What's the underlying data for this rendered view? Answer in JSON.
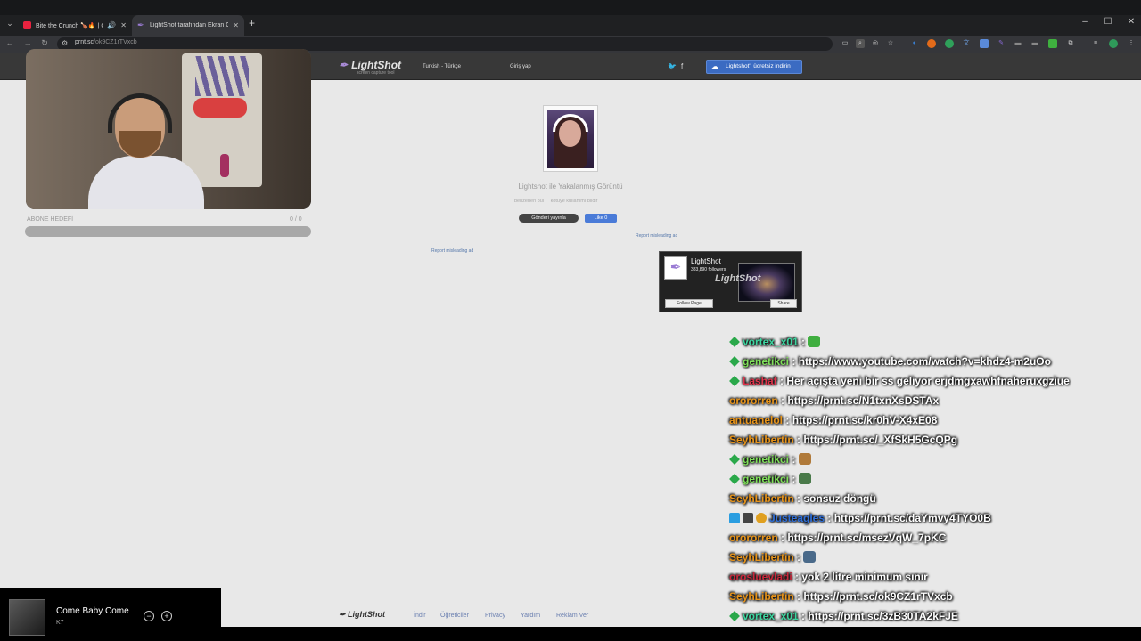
{
  "browser": {
    "tabs": [
      {
        "title": "Bite the Crunch 🍗🔥 | Chi",
        "favicon": "youtube-icon",
        "active": false
      },
      {
        "title": "LightShot tarafından Ekran Gör",
        "favicon": "lightshot-feather-icon",
        "active": true
      }
    ],
    "url_host": "prnt.sc",
    "url_path": "/ok9CZ1rTVxcb",
    "window_controls": [
      "minimize",
      "maximize",
      "close"
    ]
  },
  "lightshot": {
    "logo": "LightShot",
    "logo_sub": "screen capture tool",
    "language": "Turkish - Türkçe",
    "login": "Giriş yap",
    "download_button": "Lightshot'ı ücretsiz indirin",
    "caption": "Lightshot ile Yakalanmış Görüntü",
    "sublinks": [
      "benzerleri bul",
      "kötüye kullanımı bildir"
    ],
    "tweet_button": "Gönderi yayınla",
    "like_button": "Like 0",
    "report_ad": "Report misleading ad",
    "fb_widget": {
      "page_name": "LightShot",
      "followers": "383,890 followers",
      "follow_button": "Follow Page",
      "share_button": "Share",
      "watermark": "LightShot"
    },
    "footer": {
      "logo": "LightShot",
      "links": [
        "İndir",
        "Öğreticiler",
        "Privacy",
        "Yardım",
        "Reklam Ver"
      ]
    }
  },
  "overlay": {
    "webcam_label": "ABONE HEDEFİ",
    "webcam_count": "0 / 0",
    "chat": [
      {
        "user": "vortex_x01",
        "color": "#3dd6a0",
        "badges": [
          "mod"
        ],
        "text": "",
        "emote": "#3fae3f"
      },
      {
        "user": "genetikci",
        "color": "#7fe05a",
        "badges": [
          "mod"
        ],
        "text": "https://www.youtube.com/watch?v=khdz4-m2uOo",
        "emote": ""
      },
      {
        "user": "Lashaf",
        "color": "#e0344c",
        "badges": [
          "mod"
        ],
        "text": "Her açışta yeni bir ss geliyor erjdmgxawhfnaheruxgziue",
        "emote": ""
      },
      {
        "user": "orororren",
        "color": "#e8941a",
        "badges": [],
        "text": "https://prnt.sc/N1txnXsDSTAx",
        "emote": ""
      },
      {
        "user": "antuanelol",
        "color": "#e8941a",
        "badges": [],
        "text": "https://prnt.sc/kr0hV-X4xE08",
        "emote": ""
      },
      {
        "user": "SeyhLibertin",
        "color": "#e8941a",
        "badges": [],
        "text": "https://prnt.sc/_XfSkH5GcQPg",
        "emote": ""
      },
      {
        "user": "genetikci",
        "color": "#7fe05a",
        "badges": [
          "mod"
        ],
        "text": "",
        "emote": "#b07a3a"
      },
      {
        "user": "genetikci",
        "color": "#7fe05a",
        "badges": [
          "mod"
        ],
        "text": "",
        "emote": "#4a7a4a"
      },
      {
        "user": "SeyhLibertin",
        "color": "#e8941a",
        "badges": [],
        "text": "sonsuz döngü",
        "emote": ""
      },
      {
        "user": "Justeagles",
        "color": "#2f6fd8",
        "badges": [
          "vip",
          "sub",
          "gold"
        ],
        "text": "https://prnt.sc/daYmvy4TYO0B",
        "emote": ""
      },
      {
        "user": "orororren",
        "color": "#e8941a",
        "badges": [],
        "text": "https://prnt.sc/msezVqW_7pKC",
        "emote": ""
      },
      {
        "user": "SeyhLibertin",
        "color": "#e8941a",
        "badges": [],
        "text": "",
        "emote": "#4a6a8a"
      },
      {
        "user": "orosluevladi",
        "color": "#c8283c",
        "badges": [],
        "text": "yok 2 litre minimum sınır",
        "emote": ""
      },
      {
        "user": "SeyhLibertin",
        "color": "#e8941a",
        "badges": [],
        "text": "https://prnt.sc/ok9CZ1rTVxcb",
        "emote": ""
      },
      {
        "user": "vortex_x01",
        "color": "#3dd6a0",
        "badges": [
          "mod"
        ],
        "text": "https://prnt.sc/3zB30TA2kFJE",
        "emote": ""
      }
    ],
    "music": {
      "song": "Come Baby Come",
      "artist": "K7"
    }
  }
}
